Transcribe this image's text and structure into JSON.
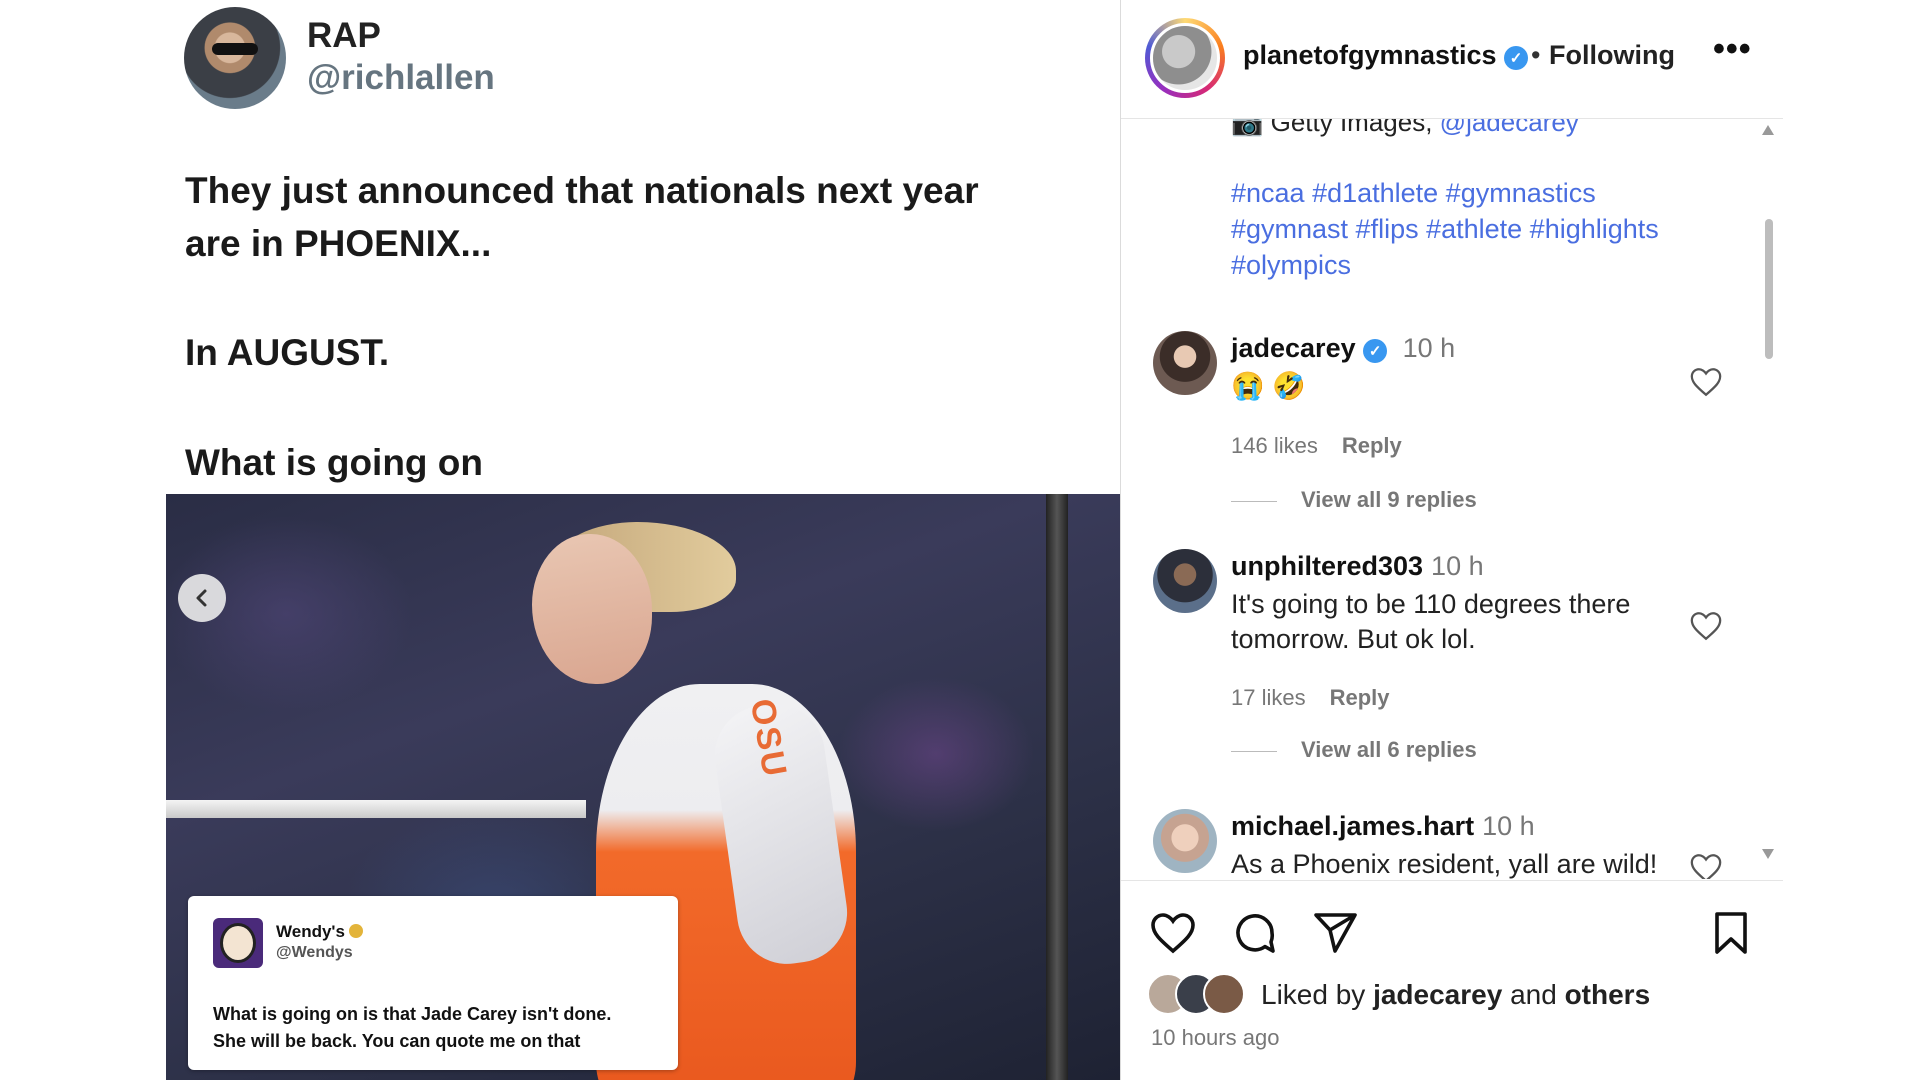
{
  "tweet": {
    "name": "RAP",
    "handle": "@richlallen",
    "text_lines": [
      "They just announced that nationals next year",
      "are in PHOENIX...",
      "In AUGUST.",
      "What is going on"
    ]
  },
  "embedded_tweet": {
    "name": "Wendy's",
    "handle": "@Wendys",
    "text_line1": "What is going on is that Jade Carey isn't done.",
    "text_line2": "She will be back. You can quote me on that"
  },
  "photo": {
    "jersey_text": "OSU"
  },
  "instagram": {
    "username": "planetofgymnastics",
    "follow_status": "Following",
    "more_label": "•••",
    "caption": {
      "credit_prefix": "📷 Getty Images, ",
      "credit_mention": "@jadecarey",
      "hashtags_line1": "#ncaa #d1athlete #gymnastics",
      "hashtags_line2": "#gymnast #flips #athlete #highlights",
      "hashtags_line3": "#olympics"
    },
    "comments": [
      {
        "user": "jadecarey",
        "verified": true,
        "time": "10 h",
        "text": "😭 🤣",
        "likes": "146 likes",
        "reply": "Reply",
        "view_replies": "View all 9 replies"
      },
      {
        "user": "unphiltered303",
        "verified": false,
        "time": "10 h",
        "text": "It's going to be 110 degrees there tomorrow. But ok lol.",
        "likes": "17 likes",
        "reply": "Reply",
        "view_replies": "View all 6 replies"
      },
      {
        "user": "michael.james.hart",
        "verified": false,
        "time": "10 h",
        "text": "As a Phoenix resident, yall are wild!"
      }
    ],
    "liked_by_prefix": "Liked by ",
    "liked_by_user": "jadecarey",
    "liked_by_and": " and ",
    "liked_by_others": "others",
    "post_time": "10 hours ago"
  },
  "icons": [
    "heart-icon",
    "comment-icon",
    "share-icon",
    "bookmark-icon",
    "verified-icon",
    "chevron-left-icon",
    "more-icon"
  ],
  "colors": {
    "link": "#4a6ee0",
    "verified": "#3897f0",
    "jersey_orange": "#f26a2a"
  }
}
